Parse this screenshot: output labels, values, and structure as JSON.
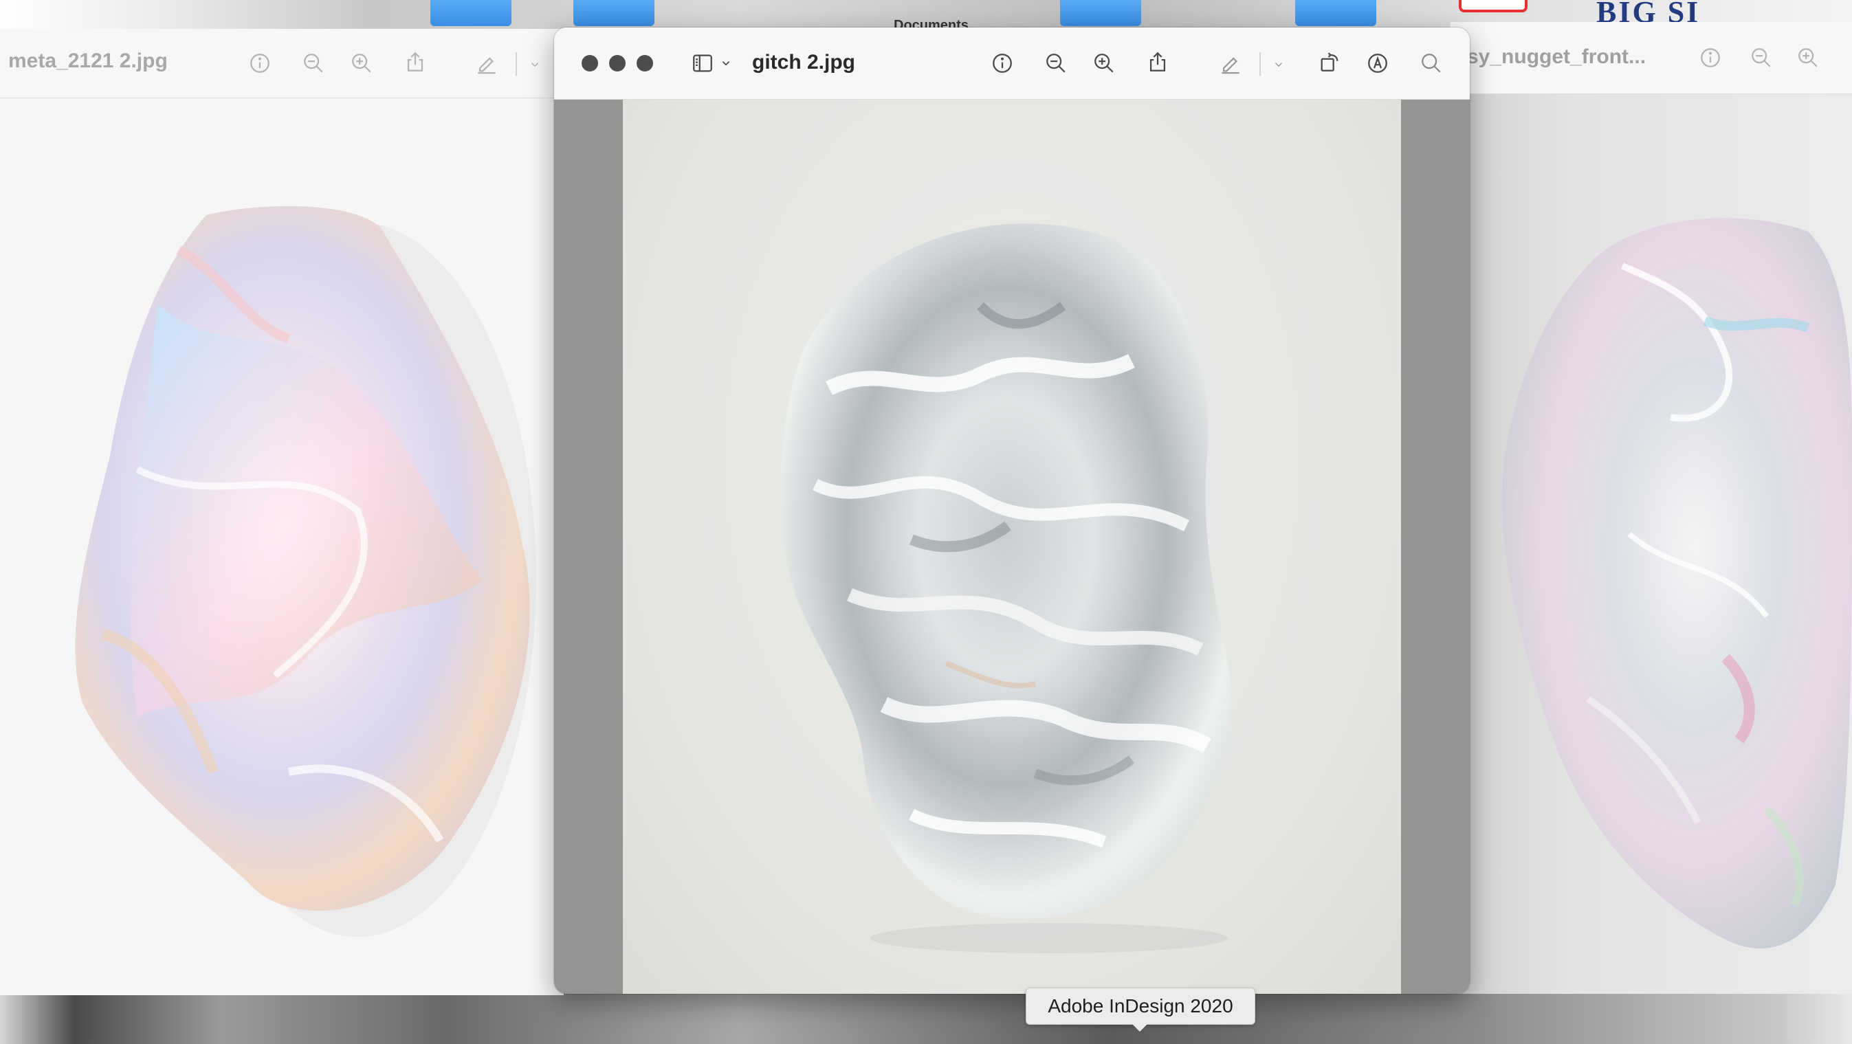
{
  "desktop": {
    "top_label": "Documents",
    "right_text": "BIG SI"
  },
  "windows": {
    "left": {
      "title": "meta_2121 2.jpg",
      "icons": [
        "info-icon",
        "zoom-out-icon",
        "zoom-in-icon",
        "share-icon",
        "markup-pen-icon",
        "chevron-down-icon"
      ]
    },
    "center": {
      "title": "gitch 2.jpg",
      "icons": [
        "sidebar-icon",
        "chevron-down-icon",
        "info-icon",
        "zoom-out-icon",
        "zoom-in-icon",
        "share-icon",
        "markup-pen-icon",
        "chevron-down-icon",
        "rotate-icon",
        "markup-circle-icon",
        "search-icon"
      ]
    },
    "right": {
      "title": "sy_nugget_front...",
      "icons": [
        "info-icon",
        "zoom-out-icon",
        "zoom-in-icon"
      ]
    }
  },
  "tooltip": {
    "text": "Adobe InDesign 2020"
  },
  "colors": {
    "desktop_icon_blue": "#4a9cf0",
    "badge_red": "#e53030",
    "viewer_gray": "#949494"
  }
}
